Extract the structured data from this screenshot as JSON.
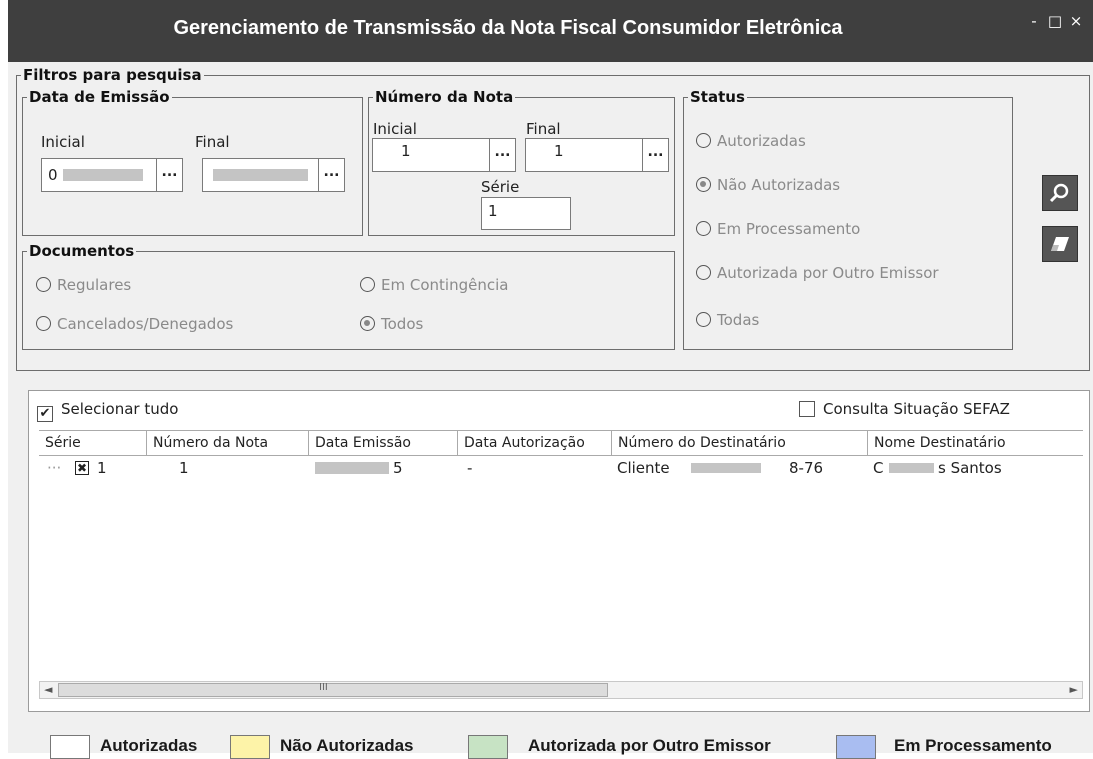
{
  "window": {
    "title": "Gerenciamento de Transmissão da Nota Fiscal Consumidor Eletrônica",
    "controls": {
      "minimize": "‐",
      "maximize": "□",
      "close": "×"
    }
  },
  "filters": {
    "legend": "Filtros para pesquisa",
    "emission_date": {
      "legend": "Data de Emissão",
      "initial_label": "Inicial",
      "final_label": "Final",
      "initial_value": "0",
      "final_value": "",
      "picker_label": "..."
    },
    "note_number": {
      "legend": "Número da Nota",
      "initial_label": "Inicial",
      "final_label": "Final",
      "initial_value": "1",
      "final_value": "1",
      "series_label": "Série",
      "series_value": "1",
      "picker_label": "..."
    },
    "documents": {
      "legend": "Documentos",
      "options": [
        "Regulares",
        "Em Contingência",
        "Cancelados/Denegados",
        "Todos"
      ],
      "selected": "Todos"
    },
    "status": {
      "legend": "Status",
      "options": [
        "Autorizadas",
        "Não Autorizadas",
        "Em Processamento",
        "Autorizada por Outro Emissor",
        "Todas"
      ],
      "selected": "Não Autorizadas"
    },
    "buttons": {
      "search_icon": "magnifier-icon",
      "clear_icon": "eraser-icon"
    }
  },
  "results": {
    "select_all_label": "Selecionar tudo",
    "select_all_checked": true,
    "sefaz_label": "Consulta Situação SEFAZ",
    "sefaz_checked": false,
    "columns": [
      "Série",
      "Número da Nota",
      "Data Emissão",
      "Data Autorização",
      "Número do Destinatário",
      "Nome Destinatário"
    ],
    "rows": [
      {
        "serie": "1",
        "numero": "1",
        "data_emissao": "5",
        "data_autorizacao": "-",
        "destinatario_numero_prefix": "Cliente",
        "destinatario_numero_suffix": "8-76",
        "destinatario_nome_prefix": "C",
        "destinatario_nome_suffix": "s Santos"
      }
    ],
    "scrollbar": {
      "left_arrow": "◄",
      "right_arrow": "►",
      "grip": "III"
    }
  },
  "legend_bar": {
    "items": [
      {
        "label": "Autorizadas",
        "color": "#ffffff"
      },
      {
        "label": "Não Autorizadas",
        "color": "#fdf3a8"
      },
      {
        "label": "Autorizada por Outro Emissor",
        "color": "#c7e3c4"
      },
      {
        "label": "Em Processamento",
        "color": "#a9bdf1"
      }
    ]
  }
}
